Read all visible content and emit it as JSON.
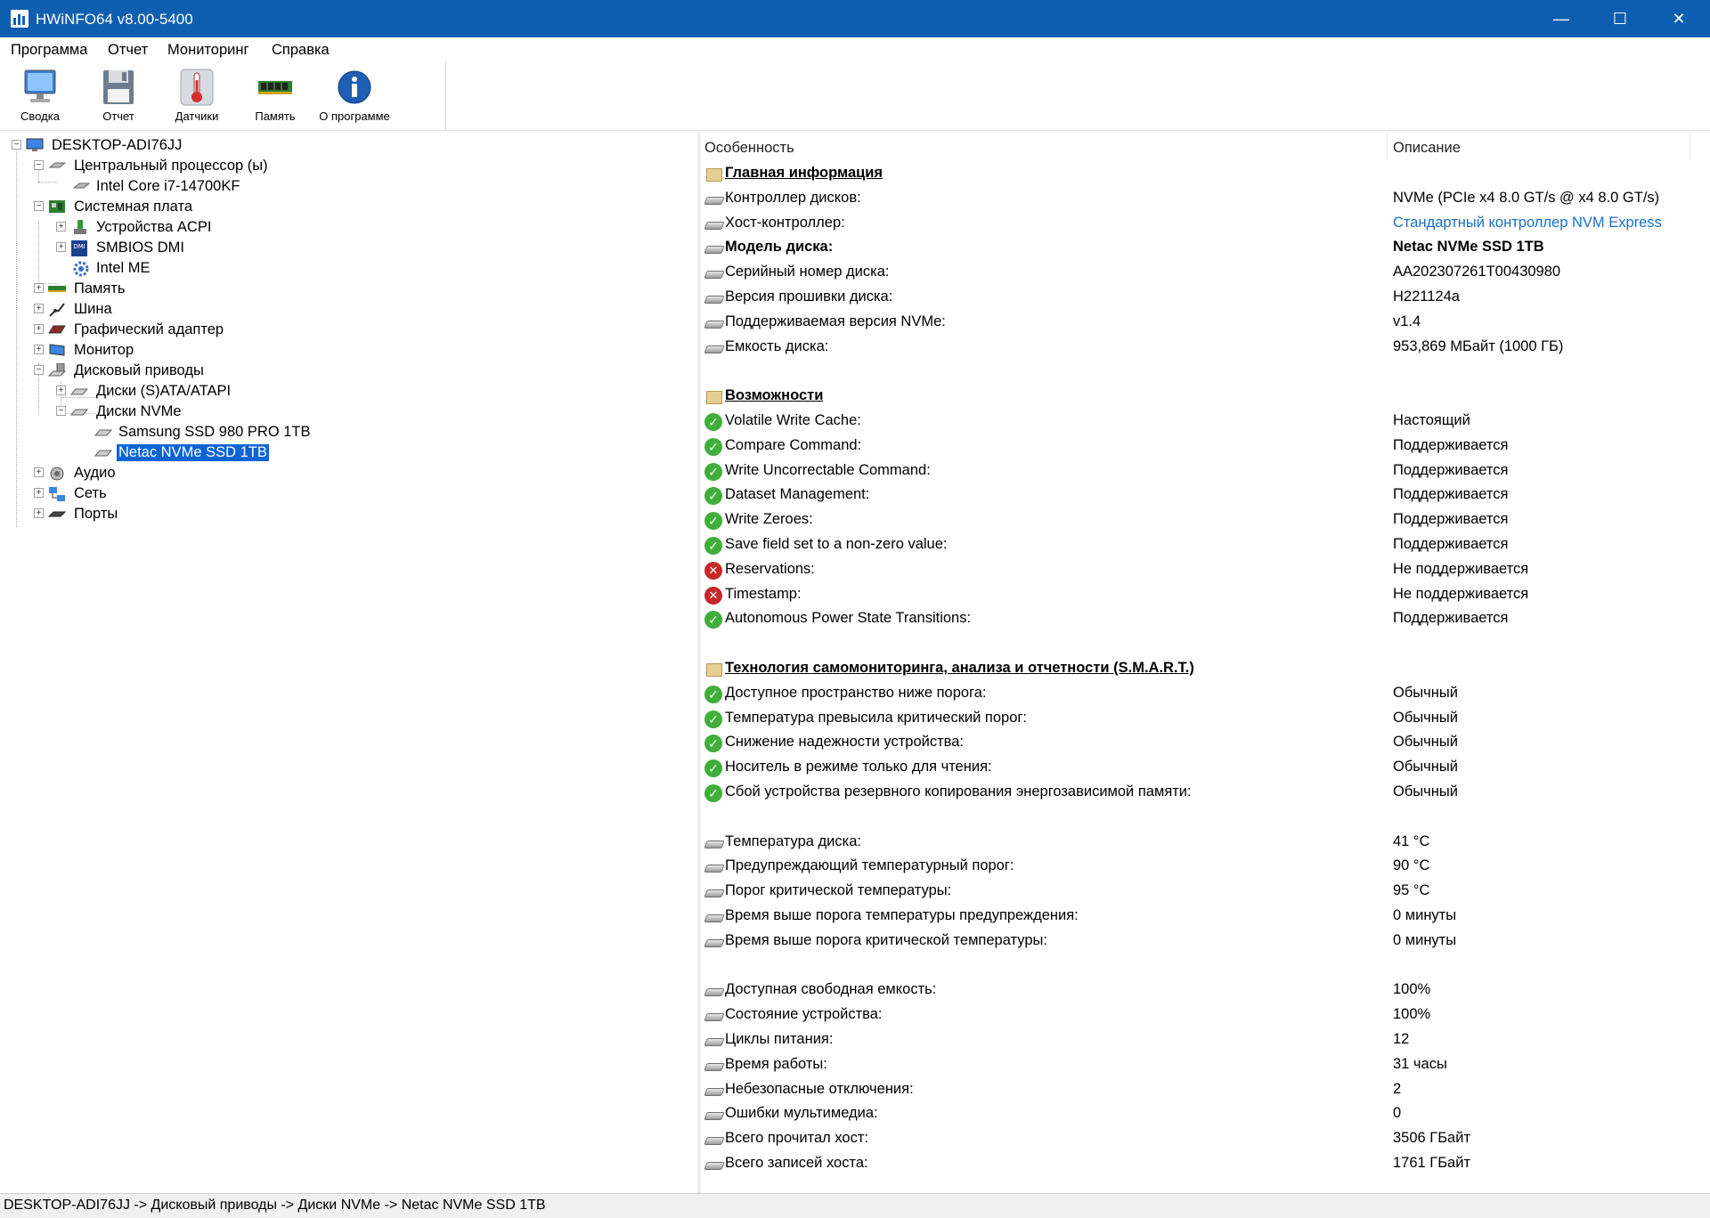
{
  "window": {
    "title": "HWiNFO64 v8.00-5400",
    "minimize": "—",
    "maximize": "☐",
    "close": "✕"
  },
  "menu": [
    "Программа",
    "Отчет",
    "Мониторинг",
    "Справка"
  ],
  "toolbar": [
    {
      "label": "Сводка",
      "icon": "monitor-icon"
    },
    {
      "label": "Отчет",
      "icon": "floppy-icon"
    },
    {
      "label": "Датчики",
      "icon": "thermometer-icon"
    },
    {
      "label": "Память",
      "icon": "memory-module-icon"
    },
    {
      "label": "О программе",
      "icon": "info-icon"
    }
  ],
  "tree": [
    {
      "label": "DESKTOP-ADI76JJ",
      "expander": "−",
      "icon": "computer-icon"
    },
    {
      "label": "Центральный процессор (ы)",
      "expander": "−",
      "icon": "cpu-icon"
    },
    {
      "label": "Intel Core i7-14700KF",
      "expander": "",
      "icon": "cpu-icon"
    },
    {
      "label": "Системная плата",
      "expander": "−",
      "icon": "motherboard-icon"
    },
    {
      "label": "Устройства ACPI",
      "expander": "+",
      "icon": "acpi-icon"
    },
    {
      "label": "SMBIOS DMI",
      "expander": "+",
      "icon": "dmi-icon"
    },
    {
      "label": "Intel ME",
      "expander": "",
      "icon": "gear-icon"
    },
    {
      "label": "Память",
      "expander": "+",
      "icon": "memory-module-icon"
    },
    {
      "label": "Шина",
      "expander": "+",
      "icon": "bus-icon"
    },
    {
      "label": "Графический адаптер",
      "expander": "+",
      "icon": "graphics-card-icon"
    },
    {
      "label": "Монитор",
      "expander": "+",
      "icon": "monitor-icon"
    },
    {
      "label": "Дисковый приводы",
      "expander": "−",
      "icon": "disk-drive-icon"
    },
    {
      "label": "Диски (S)ATA/ATAPI",
      "expander": "+",
      "icon": "drive-icon"
    },
    {
      "label": "Диски NVMe",
      "expander": "−",
      "icon": "drive-icon"
    },
    {
      "label": "Samsung SSD 980 PRO 1TB",
      "expander": "",
      "icon": "drive-icon"
    },
    {
      "label": "Netac NVMe SSD 1TB",
      "expander": "",
      "icon": "drive-icon",
      "selected": true
    },
    {
      "label": "Аудио",
      "expander": "+",
      "icon": "speaker-icon"
    },
    {
      "label": "Сеть",
      "expander": "+",
      "icon": "network-icon"
    },
    {
      "label": "Порты",
      "expander": "+",
      "icon": "port-icon"
    }
  ],
  "columns": {
    "feature": "Особенность",
    "description": "Описание"
  },
  "rows": [
    {
      "type": "section",
      "label": "Главная информация",
      "value": ""
    },
    {
      "type": "item",
      "icon": "drive",
      "label": "Контроллер дисков:",
      "value": "NVMe (PCIe x4 8.0 GT/s @ x4 8.0 GT/s)"
    },
    {
      "type": "item",
      "icon": "drive",
      "label": "Хост-контроллер:",
      "value": "Стандартный контроллер NVM Express",
      "link": true
    },
    {
      "type": "item",
      "icon": "drive",
      "label": "Модель диска:",
      "value": "Netac NVMe SSD 1TB",
      "bold": true
    },
    {
      "type": "item",
      "icon": "drive",
      "label": "Серийный номер диска:",
      "value": "AA202307261T00430980"
    },
    {
      "type": "item",
      "icon": "drive",
      "label": "Версия прошивки диска:",
      "value": "H221124a"
    },
    {
      "type": "item",
      "icon": "drive",
      "label": "Поддерживаемая версия NVMe:",
      "value": "v1.4"
    },
    {
      "type": "item",
      "icon": "drive",
      "label": "Емкость диска:",
      "value": "953,869 МБайт (1000 ГБ)"
    },
    {
      "type": "blank"
    },
    {
      "type": "section",
      "label": "Возможности",
      "value": ""
    },
    {
      "type": "item",
      "icon": "ok",
      "label": "Volatile Write Cache:",
      "value": "Настоящий"
    },
    {
      "type": "item",
      "icon": "ok",
      "label": "Compare Command:",
      "value": "Поддерживается"
    },
    {
      "type": "item",
      "icon": "ok",
      "label": "Write Uncorrectable Command:",
      "value": "Поддерживается"
    },
    {
      "type": "item",
      "icon": "ok",
      "label": "Dataset Management:",
      "value": "Поддерживается"
    },
    {
      "type": "item",
      "icon": "ok",
      "label": "Write Zeroes:",
      "value": "Поддерживается"
    },
    {
      "type": "item",
      "icon": "ok",
      "label": "Save field set to a non-zero value:",
      "value": "Поддерживается"
    },
    {
      "type": "item",
      "icon": "no",
      "label": "Reservations:",
      "value": "Не поддерживается"
    },
    {
      "type": "item",
      "icon": "no",
      "label": "Timestamp:",
      "value": "Не поддерживается"
    },
    {
      "type": "item",
      "icon": "ok",
      "label": "Autonomous Power State Transitions:",
      "value": "Поддерживается"
    },
    {
      "type": "blank"
    },
    {
      "type": "section",
      "label": "Технология самомониторинга, анализа и отчетности (S.M.A.R.T.)",
      "value": ""
    },
    {
      "type": "item",
      "icon": "ok",
      "label": "Доступное пространство ниже порога:",
      "value": "Обычный"
    },
    {
      "type": "item",
      "icon": "ok",
      "label": "Температура превысила критический порог:",
      "value": "Обычный"
    },
    {
      "type": "item",
      "icon": "ok",
      "label": "Снижение надежности устройства:",
      "value": "Обычный"
    },
    {
      "type": "item",
      "icon": "ok",
      "label": "Носитель в режиме только для чтения:",
      "value": "Обычный"
    },
    {
      "type": "item",
      "icon": "ok",
      "label": "Сбой устройства резервного копирования энергозависимой памяти:",
      "value": "Обычный"
    },
    {
      "type": "blank"
    },
    {
      "type": "item",
      "icon": "drive",
      "label": "Температура диска:",
      "value": "41 °C"
    },
    {
      "type": "item",
      "icon": "drive",
      "label": "Предупреждающий температурный порог:",
      "value": "90 °C"
    },
    {
      "type": "item",
      "icon": "drive",
      "label": "Порог критической температуры:",
      "value": "95 °C"
    },
    {
      "type": "item",
      "icon": "drive",
      "label": "Время выше порога температуры предупреждения:",
      "value": "0 минуты"
    },
    {
      "type": "item",
      "icon": "drive",
      "label": "Время выше порога критической температуры:",
      "value": "0 минуты"
    },
    {
      "type": "blank"
    },
    {
      "type": "item",
      "icon": "drive",
      "label": "Доступная свободная емкость:",
      "value": "100%"
    },
    {
      "type": "item",
      "icon": "drive",
      "label": "Состояние устройства:",
      "value": "100%"
    },
    {
      "type": "item",
      "icon": "drive",
      "label": "Циклы питания:",
      "value": "12"
    },
    {
      "type": "item",
      "icon": "drive",
      "label": "Время работы:",
      "value": "31 часы"
    },
    {
      "type": "item",
      "icon": "drive",
      "label": "Небезопасные отключения:",
      "value": "2"
    },
    {
      "type": "item",
      "icon": "drive",
      "label": "Ошибки мультимедиа:",
      "value": "0"
    },
    {
      "type": "item",
      "icon": "drive",
      "label": "Всего прочитал хост:",
      "value": "3506 ГБайт"
    },
    {
      "type": "item",
      "icon": "drive",
      "label": "Всего записей хоста:",
      "value": "1761 ГБайт"
    }
  ],
  "status": "DESKTOP-ADI76JJ -> Дисковый приводы -> Диски NVMe -> Netac NVMe SSD 1TB"
}
